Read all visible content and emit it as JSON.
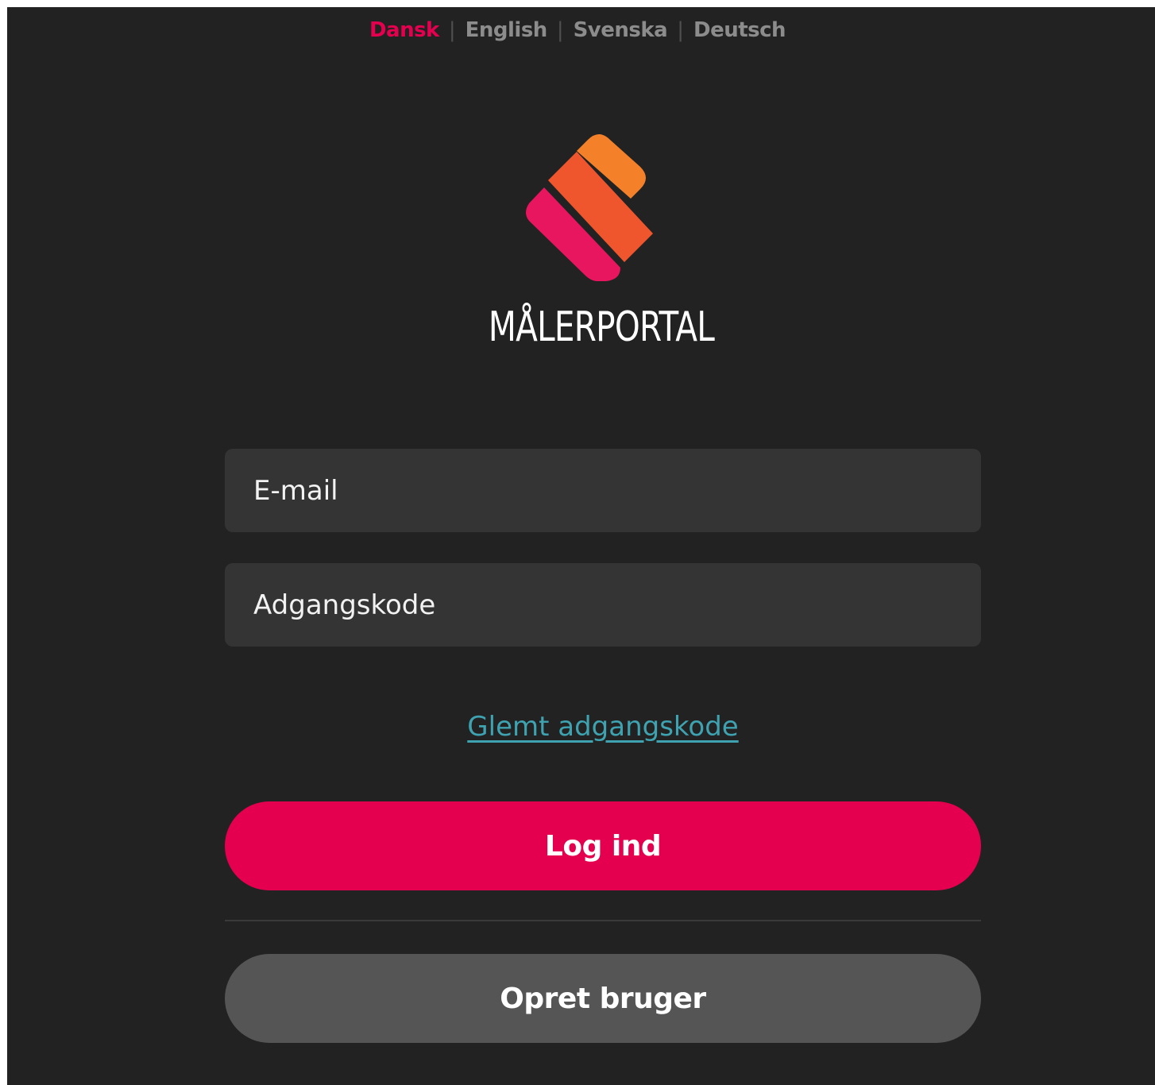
{
  "languages": {
    "items": [
      {
        "label": "Dansk",
        "active": true
      },
      {
        "label": "English",
        "active": false
      },
      {
        "label": "Svenska",
        "active": false
      },
      {
        "label": "Deutsch",
        "active": false
      }
    ],
    "separator": "|"
  },
  "brand": {
    "name": "MÅLERPORTAL",
    "logo_colors": [
      "#f4812a",
      "#f0562e",
      "#e8155f"
    ]
  },
  "form": {
    "email_placeholder": "E-mail",
    "password_placeholder": "Adgangskode",
    "forgot_password_label": "Glemt adgangskode",
    "login_label": "Log ind",
    "signup_label": "Opret bruger"
  },
  "colors": {
    "accent": "#e4004f",
    "background": "#222222",
    "field": "#343434",
    "secondary_button": "#555555",
    "link": "#3fa2b0"
  }
}
